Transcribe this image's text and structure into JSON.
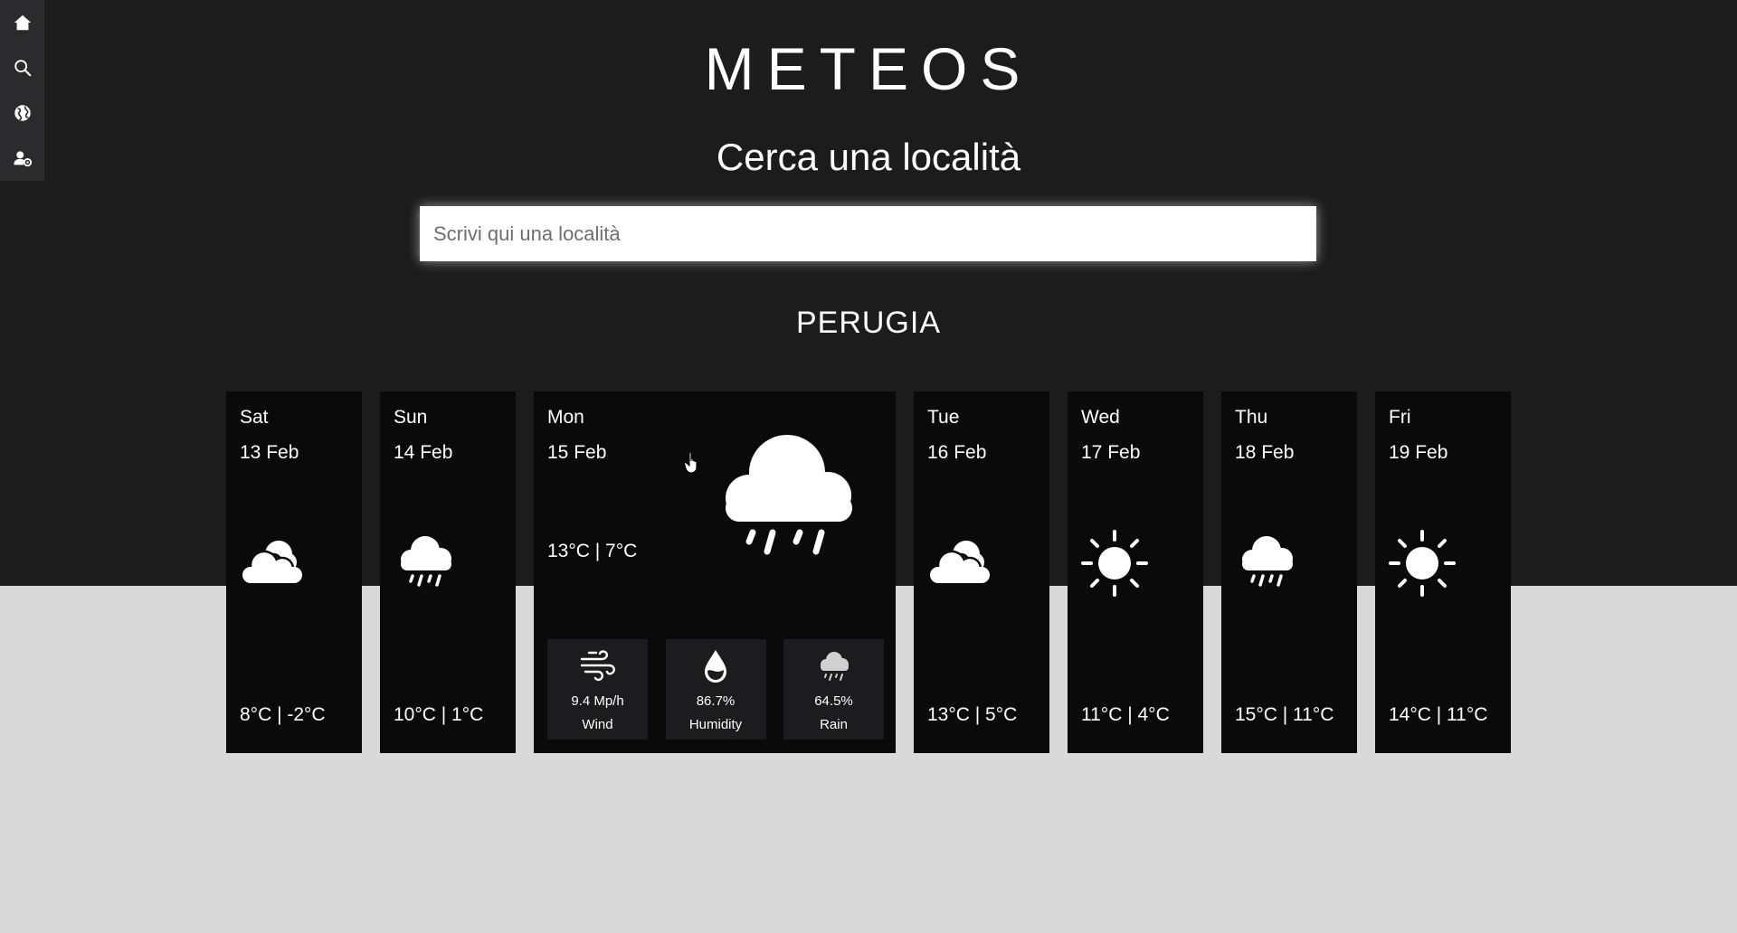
{
  "sidebar": {
    "items": [
      {
        "icon": "home-icon"
      },
      {
        "icon": "search-icon"
      },
      {
        "icon": "globe-icon"
      },
      {
        "icon": "user-settings-icon"
      }
    ]
  },
  "header": {
    "title": "METEOS",
    "search_heading": "Cerca una località"
  },
  "search": {
    "placeholder": "Scrivi qui una località",
    "value": ""
  },
  "location": {
    "city": "PERUGIA"
  },
  "forecast": [
    {
      "day": "Sat",
      "date": "13 Feb",
      "temp": "8°C | -2°C",
      "icon": "partly-cloudy-icon"
    },
    {
      "day": "Sun",
      "date": "14 Feb",
      "temp": "10°C | 1°C",
      "icon": "rain-cloud-icon"
    },
    {
      "day": "Mon",
      "date": "15 Feb",
      "temp": "13°C | 7°C",
      "icon": "rain-cloud-icon",
      "details": {
        "wind": {
          "value": "9.4 Mp/h",
          "label": "Wind"
        },
        "humidity": {
          "value": "86.7%",
          "label": "Humidity"
        },
        "rain": {
          "value": "64.5%",
          "label": "Rain"
        }
      }
    },
    {
      "day": "Tue",
      "date": "16 Feb",
      "temp": "13°C | 5°C",
      "icon": "partly-cloudy-icon"
    },
    {
      "day": "Wed",
      "date": "17 Feb",
      "temp": "11°C | 4°C",
      "icon": "sun-icon"
    },
    {
      "day": "Thu",
      "date": "18 Feb",
      "temp": "15°C | 11°C",
      "icon": "rain-cloud-icon"
    },
    {
      "day": "Fri",
      "date": "19 Feb",
      "temp": "14°C | 11°C",
      "icon": "sun-icon"
    }
  ],
  "colors": {
    "header_background": "#1c1c1d",
    "page_background": "#d9d9d9",
    "card_background": "#0a0a0b",
    "metric_background": "#1c1c1e",
    "sidebar_background": "#2b2b2d",
    "text": "#ffffff"
  }
}
